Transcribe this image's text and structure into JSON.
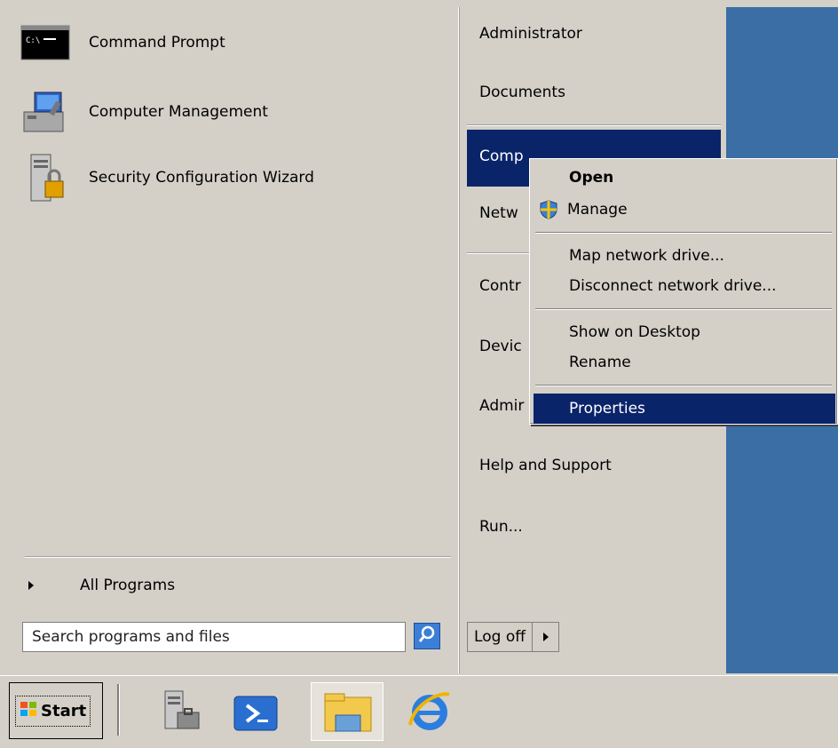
{
  "programs": {
    "items": [
      {
        "label": "Command Prompt",
        "icon": "command-prompt-icon"
      },
      {
        "label": "Computer Management",
        "icon": "computer-management-icon"
      },
      {
        "label": "Security Configuration Wizard",
        "icon": "security-wizard-icon"
      }
    ],
    "all_programs_label": "All Programs"
  },
  "search": {
    "placeholder": "Search programs and files"
  },
  "right_menu": {
    "items": [
      "Administrator",
      "Documents",
      "Computer",
      "Network",
      "Control Panel",
      "Devices and Printers",
      "Administrative Tools",
      "Help and Support",
      "Run..."
    ],
    "visible": {
      "network": "Netw",
      "control": "Contr",
      "devices": "Devic",
      "admin": "Admir",
      "computer": "Comp"
    },
    "logoff_label": "Log off"
  },
  "context_menu": {
    "open": "Open",
    "manage": "Manage",
    "map_drive": "Map network drive...",
    "disconnect_drive": "Disconnect network drive...",
    "show_desktop": "Show on Desktop",
    "rename": "Rename",
    "properties": "Properties"
  },
  "taskbar": {
    "start_label": "Start",
    "apps": [
      "server-manager-icon",
      "powershell-icon",
      "file-explorer-icon",
      "internet-explorer-icon"
    ]
  },
  "colors": {
    "selection": "#0a246a",
    "desktop": "#3a6ea5",
    "classic_gray": "#d4d0c8"
  }
}
